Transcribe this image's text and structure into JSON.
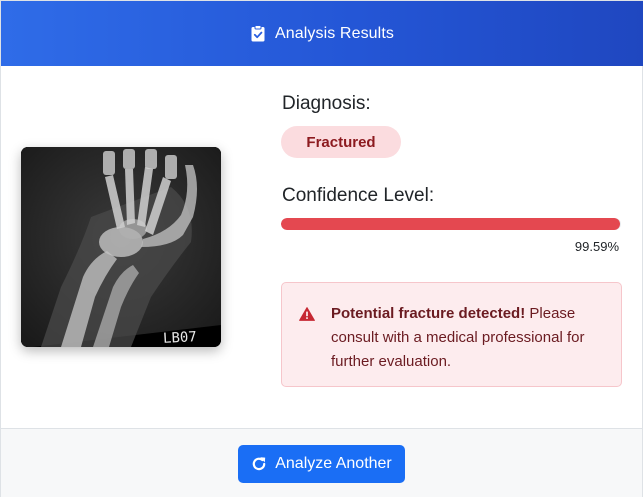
{
  "header": {
    "title": "Analysis Results",
    "icon": "clipboard-check-icon"
  },
  "image": {
    "description_icon": "xray-image",
    "marker_text": "LB07"
  },
  "diagnosis": {
    "label": "Diagnosis:",
    "result": "Fractured",
    "badge_color": "#fbdcdf",
    "badge_text_color": "#8c1a1f"
  },
  "confidence": {
    "label": "Confidence Level:",
    "value_text": "99.59%",
    "value": 0.9959,
    "bar_color": "#e44850"
  },
  "alert": {
    "icon": "warning-triangle-icon",
    "bold_text": "Potential fracture detected!",
    "text": " Please consult with a medical professional for further evaluation."
  },
  "footer": {
    "button_label": "Analyze Another",
    "button_icon": "redo-icon",
    "button_color": "#1a6ef5"
  }
}
